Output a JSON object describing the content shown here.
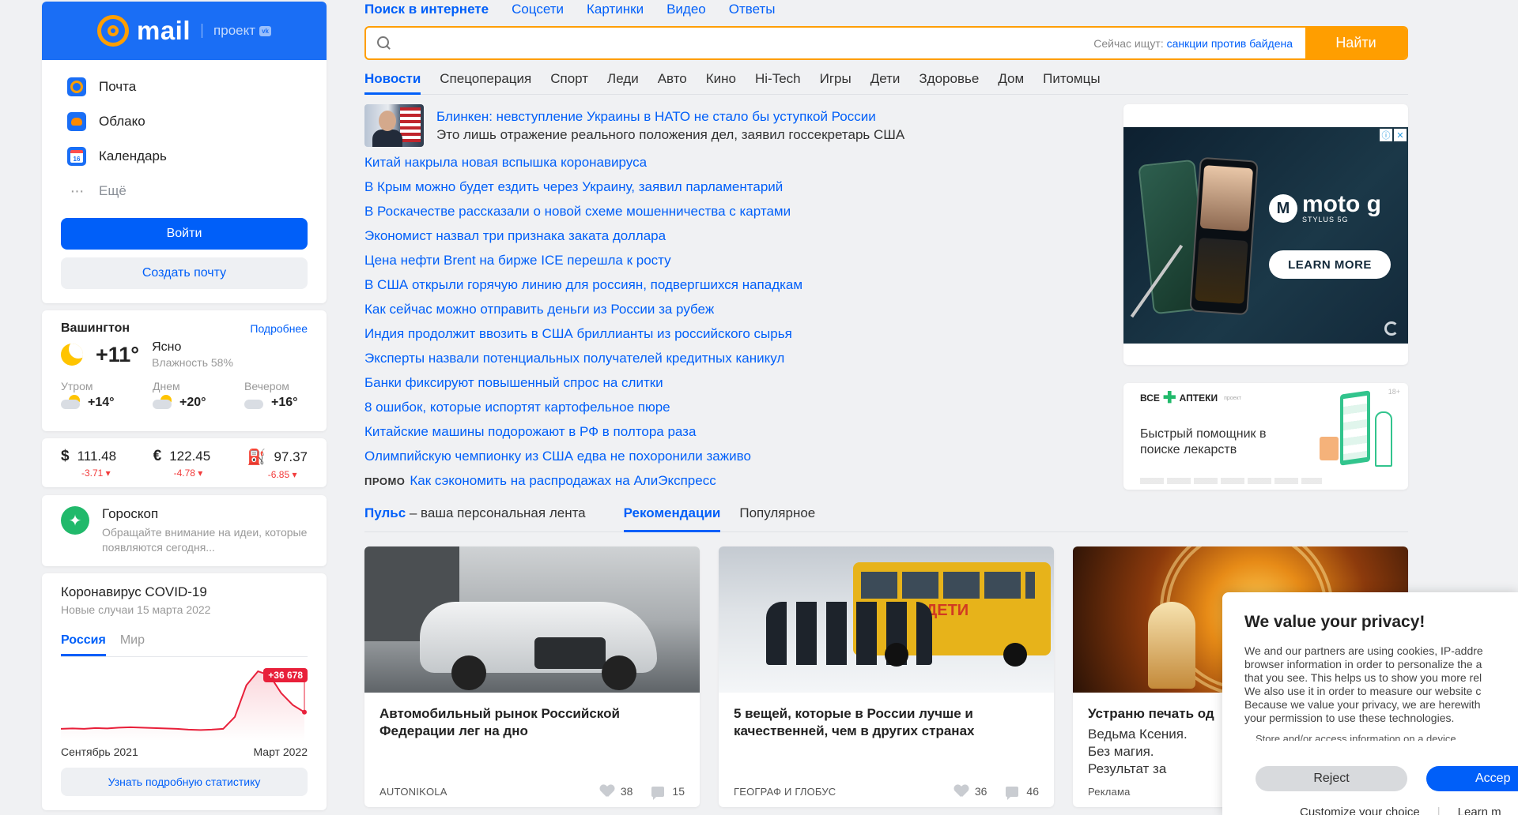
{
  "sidebar": {
    "logo_text": "mail",
    "logo_project": "проект",
    "services": [
      {
        "label": "Почта"
      },
      {
        "label": "Облако"
      },
      {
        "label": "Календарь"
      },
      {
        "label": "Ещё"
      }
    ],
    "calendar_day": "16",
    "login_label": "Войти",
    "create_label": "Создать почту"
  },
  "weather": {
    "city": "Вашингтон",
    "more": "Подробнее",
    "temp": "+11°",
    "desc": "Ясно",
    "humidity": "Влажность 58%",
    "parts": [
      {
        "label": "Утром",
        "temp": "+14°"
      },
      {
        "label": "Днем",
        "temp": "+20°"
      },
      {
        "label": "Вечером",
        "temp": "+16°"
      }
    ]
  },
  "currency": [
    {
      "symbol": "$",
      "value": "111.48",
      "change": "-3.71 ▾"
    },
    {
      "symbol": "€",
      "value": "122.45",
      "change": "-4.78 ▾"
    },
    {
      "symbol": "⛽",
      "value": "97.37",
      "change": "-6.85 ▾"
    }
  ],
  "horoscope": {
    "title": "Гороскоп",
    "text": "Обращайте внимание на идеи, которые появляются сегодня..."
  },
  "covid": {
    "title": "Коронавирус COVID-19",
    "subtitle": "Новые случаи 15 марта 2022",
    "tabs": [
      "Россия",
      "Мир"
    ],
    "badge": "+36 678",
    "date_start": "Сентябрь 2021",
    "date_end": "Март 2022",
    "button": "Узнать подробную статистику",
    "chart_data": {
      "type": "line",
      "values": [
        30,
        31,
        30,
        32,
        31,
        33,
        34,
        33,
        32,
        31,
        30,
        28,
        27,
        28,
        30,
        60,
        140,
        175,
        165,
        120,
        90,
        72
      ],
      "color": "#e8203a"
    }
  },
  "search": {
    "tabs": [
      "Поиск в интернете",
      "Соцсети",
      "Картинки",
      "Видео",
      "Ответы"
    ],
    "placeholder": "",
    "hint_label": "Сейчас ищут:",
    "hint_query": "санкции против байдена",
    "button": "Найти"
  },
  "news_tabs": [
    "Новости",
    "Спецоперация",
    "Спорт",
    "Леди",
    "Авто",
    "Кино",
    "Hi-Tech",
    "Игры",
    "Дети",
    "Здоровье",
    "Дом",
    "Питомцы"
  ],
  "lead_news": {
    "title": "Блинкен: невступление Украины в НАТО не стало бы уступкой России",
    "desc": "Это лишь отражение реального положения дел, заявил госсекретарь США"
  },
  "news": [
    "Китай накрыла новая вспышка коронавируса",
    "В Крым можно будет ездить через Украину, заявил парламентарий",
    "В Роскачестве рассказали о новой схеме мошенничества с картами",
    "Экономист назвал три признака заката доллара",
    "Цена нефти Brent на бирже ICE перешла к росту",
    "В США открыли горячую линию для россиян, подвергшихся нападкам",
    "Как сейчас можно отправить деньги из России за рубеж",
    "Индия продолжит ввозить в США бриллианты из российского сырья",
    "Эксперты назвали потенциальных получателей кредитных каникул",
    "Банки фиксируют повышенный спрос на слитки",
    "8 ошибок, которые испортят картофельное пюре",
    "Китайские машины подорожают в РФ в полтора раза",
    "Олимпийскую чемпионку из США едва не похоронили заживо"
  ],
  "promo": {
    "tag": "ПРОМО",
    "text": "Как сэкономить на распродажах на АлиЭкспресс"
  },
  "ad": {
    "brand": "moto g",
    "brand_sub": "STYLUS 5G",
    "cta": "LEARN MORE"
  },
  "apteki": {
    "logo": "ВСЕ",
    "logo2": "АПТЕКИ",
    "project": "проект",
    "age": "18+",
    "text": "Быстрый помощник в поиске лекарств"
  },
  "pulse": {
    "title": "Пульс",
    "title_rest": " – ваша персональная лента",
    "tabs": [
      "Рекомендации",
      "Популярное"
    ]
  },
  "feed": [
    {
      "title": "Автомобильный рынок Российской Федерации лег на дно",
      "sub": "",
      "source": "AUTONIKOLA",
      "likes": "38",
      "comments": "15"
    },
    {
      "title": "5 вещей, которые в России лучше и качественней, чем в других странах",
      "sub": "",
      "source": "ГЕОГРАФ И ГЛОБУС",
      "likes": "36",
      "comments": "46"
    },
    {
      "title": "Устраню печать од",
      "sub": "Ведьма Ксения. Без магия. Результат за",
      "source": "Реклама",
      "likes": "",
      "comments": ""
    }
  ],
  "bus_sign": "ДЕТИ",
  "privacy": {
    "title": "We value your privacy!",
    "lines": [
      "We and our partners are using cookies, IP-addre",
      "browser information in order to personalize the a",
      "that you see. This helps us to show you more rel",
      "We also use it in order to measure our website c",
      "Because we value your privacy, we are herewith",
      "your permission to use these technologies."
    ],
    "store": "Store and/or access information on a device",
    "reject": "Reject",
    "accept": "Accep",
    "customize": "Customize your choice",
    "learn": "Learn m"
  }
}
